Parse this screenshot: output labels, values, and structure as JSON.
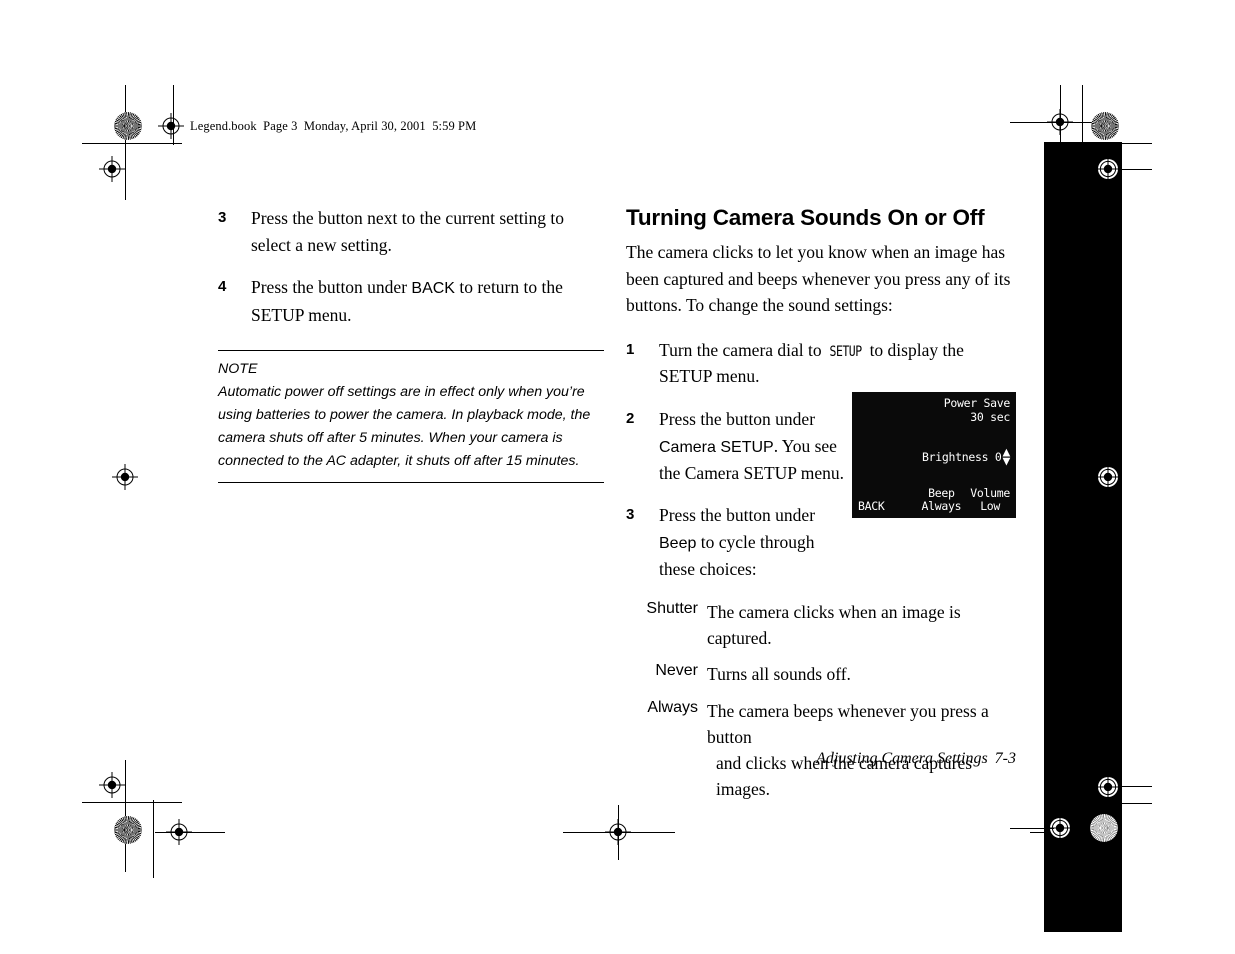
{
  "page_slug": "Legend.book  Page 3  Monday, April 30, 2001  5:59 PM",
  "left_column": {
    "steps": [
      {
        "num": "3",
        "text": "Press the button next to the current setting to select a new setting."
      },
      {
        "num": "4",
        "text_before": "Press the button under ",
        "ui_term": "BACK",
        "text_after": " to return to the SETUP menu."
      }
    ],
    "note": {
      "label": "NOTE",
      "text": "Automatic power off settings are in effect only when you’re using batteries to power the camera. In playback mode, the camera shuts off after 5 minutes. When your camera is connected to the AC adapter, it shuts off after 15 minutes."
    }
  },
  "right_column": {
    "heading": "Turning Camera Sounds On or Off",
    "intro": "The camera clicks to let you know when an image has been captured and beeps whenever you press any of its buttons. To change the sound settings:",
    "steps": [
      {
        "num": "1",
        "text_before": "Turn the camera dial to ",
        "lcd_term": "SETUP",
        "text_after": " to display the SETUP menu."
      },
      {
        "num": "2",
        "text_before": "Press the button under ",
        "ui_term": "Camera SETUP",
        "text_after": ". You see the Camera SETUP menu."
      },
      {
        "num": "3",
        "text_before": "Press the button under ",
        "ui_term": "Beep",
        "text_after": " to cycle through these choices:"
      }
    ],
    "choices": [
      {
        "term": "Shutter",
        "definition": "The camera clicks when an image is captured."
      },
      {
        "term": "Never",
        "definition": "Turns all sounds off."
      },
      {
        "term": "Always",
        "definition_line1": "The camera beeps whenever you press a button",
        "definition_line2": "and clicks when the camera captures images."
      }
    ]
  },
  "lcd_screen": {
    "power_save_label": "Power Save",
    "power_save_value": "30 sec",
    "brightness_label": "Brightness",
    "brightness_value": "0",
    "arrow_up": "▲",
    "arrow_down": "▼",
    "back_label": "BACK",
    "softkeys": [
      {
        "title": "Beep",
        "value": "Always"
      },
      {
        "title": "Volume",
        "value": "Low"
      }
    ],
    "background_color": "#0a0a0a",
    "text_color": "#ffffff"
  },
  "footer": {
    "chapter_title": "Adjusting Camera Settings",
    "page_number": "7-3"
  }
}
